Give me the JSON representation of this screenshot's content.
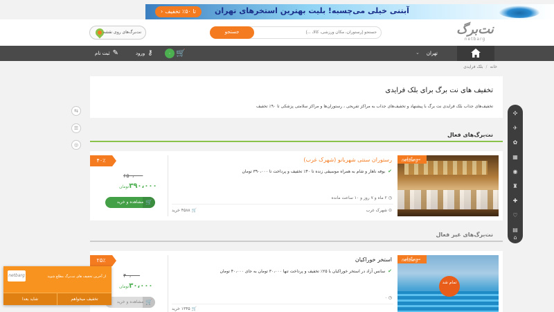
{
  "banner": {
    "text": "آبتنی خیلی می‌چسبه! بلیت بهترین استخرهای تهران",
    "button": "تا ۵۰٪ تخفیف"
  },
  "header": {
    "logo_main": "نت‌برگ",
    "logo_sub": "netbarg",
    "search_placeholder": "جستجو (رستوران، مکان ورزشی، کالا، ...)",
    "search_button": "جستجو",
    "map_button": "نت‌برگ‌های روی نقشه"
  },
  "nav": {
    "city": "تهران",
    "cart_count": "۰",
    "login": "ورود",
    "register": "ثبت نام"
  },
  "breadcrumb": {
    "home": "خانه",
    "current": "بلک فرایدی"
  },
  "intro": {
    "title": "تخفیف های نت برگ برای بلک فرایدی",
    "description": "تخفیف‌های جذاب بلک فرایدی نت برگ با پیشنهاد و تخفیف‌های جذاب به مراکز تفریحی ، رستوران‌ها و مراکز سلامتی پزشکی تا ۹۰٪ تخفیف"
  },
  "sections": {
    "active": "نت‌برگ‌های فعال",
    "inactive": "نت‌برگ‌های غیر فعال"
  },
  "deals": [
    {
      "photo_tag": "نت برگ آنی",
      "photo_brand": "netbarg",
      "title": "رستوران سنتی شهربانو (شهرک غرب)",
      "description": "بوفه ناهار و شام به همراه موسیقی زنده تا ۴۰٪ تخفیف و پرداخت تا ۳۹۰،۰۰۰ تومان",
      "time_left": "۲ ماه و ۷ روز و ۱۰ ساعت مانده",
      "location": "شهرک غرب",
      "bought": "۴۵۸۸ خرید",
      "discount": "۴۰٪",
      "old_price": "۶۵۰،۰۰۰",
      "new_price": "۳۹۰،۰۰۰",
      "currency": "تومان",
      "button": "مشاهده و خرید"
    },
    {
      "photo_tag": "نت برگ آنی",
      "photo_brand": "netbarg",
      "photo_badge": "تمام شد",
      "title": "استخر خوراکیان",
      "description": "سانس آزاد در استخر خوراکیان با ۲۵٪ تخفیف و پرداخت تنها ۳۰،۰۰۰ تومان به جای ۴۰،۰۰۰ تومان",
      "time_left": "۰",
      "location": "",
      "bought": "۱۳۴۵ خرید",
      "discount": "۲۵٪",
      "old_price": "۴۰،۰۰۰",
      "new_price": "۳۰،۰۰۰",
      "currency": "تومان",
      "button": "مشاهده و خرید"
    }
  ],
  "popup": {
    "logo": "netbarg",
    "text": "از آخرین تخفیف های نت‌برگ مطلع شوید",
    "btn_no": "شاید بعدا",
    "btn_yes": "تخفیف میخواهم"
  },
  "colors": {
    "accent": "#f47b20",
    "green": "#43a047",
    "nav": "#4a4a4a"
  }
}
